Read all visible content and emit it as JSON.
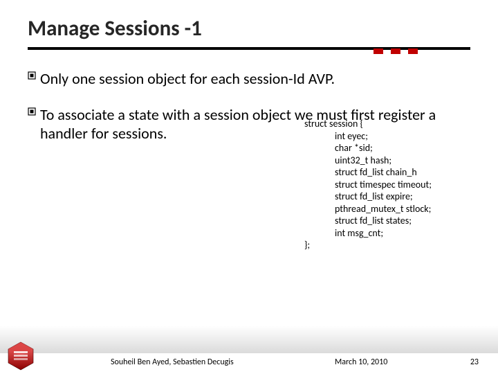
{
  "title": "Manage Sessions -1",
  "bullets": [
    "Only one session object for each session-Id AVP.",
    "To associate a state with a session object we must first register a handler for sessions."
  ],
  "code": {
    "open": "struct session {",
    "fields": [
      "int eyec;",
      "char *sid;",
      "uint32_t hash;",
      "struct fd_list chain_h",
      "struct timespec timeout;",
      "struct fd_list expire;",
      "pthread_mutex_t  stlock;",
      "struct fd_list states;",
      "int msg_cnt;"
    ],
    "close": "};"
  },
  "footer": {
    "authors": "Souheil Ben Ayed, Sebastien Decugis",
    "date": "March 10, 2010",
    "page": "23"
  }
}
